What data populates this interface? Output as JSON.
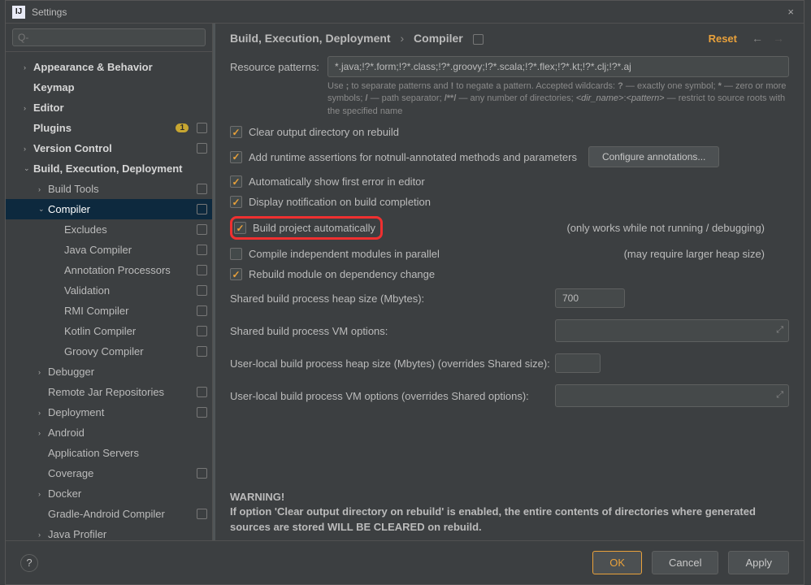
{
  "window": {
    "title": "Settings",
    "close": "×"
  },
  "search_placeholder": "Q-",
  "sidebar": {
    "items": [
      {
        "label": "Appearance & Behavior",
        "arrow": "›",
        "bold": true
      },
      {
        "label": "Keymap",
        "arrow": "",
        "bold": true
      },
      {
        "label": "Editor",
        "arrow": "›",
        "bold": true
      },
      {
        "label": "Plugins",
        "arrow": "",
        "bold": true,
        "count": "1",
        "proj": true
      },
      {
        "label": "Version Control",
        "arrow": "›",
        "bold": true,
        "proj": true
      },
      {
        "label": "Build, Execution, Deployment",
        "arrow": "⌄",
        "bold": true,
        "expanded": true
      },
      {
        "label": "Build Tools",
        "arrow": "›",
        "lvl": 2,
        "proj": true
      },
      {
        "label": "Compiler",
        "arrow": "⌄",
        "lvl": 2,
        "proj": true,
        "selected": true
      },
      {
        "label": "Excludes",
        "lvl": 3,
        "proj": true
      },
      {
        "label": "Java Compiler",
        "lvl": 3,
        "proj": true
      },
      {
        "label": "Annotation Processors",
        "lvl": 3,
        "proj": true
      },
      {
        "label": "Validation",
        "lvl": 3,
        "proj": true
      },
      {
        "label": "RMI Compiler",
        "lvl": 3,
        "proj": true
      },
      {
        "label": "Kotlin Compiler",
        "lvl": 3,
        "proj": true
      },
      {
        "label": "Groovy Compiler",
        "lvl": 3,
        "proj": true
      },
      {
        "label": "Debugger",
        "arrow": "›",
        "lvl": 2
      },
      {
        "label": "Remote Jar Repositories",
        "lvl": 2,
        "proj": true
      },
      {
        "label": "Deployment",
        "arrow": "›",
        "lvl": 2,
        "proj": true
      },
      {
        "label": "Android",
        "arrow": "›",
        "lvl": 2
      },
      {
        "label": "Application Servers",
        "lvl": 2
      },
      {
        "label": "Coverage",
        "lvl": 2,
        "proj": true
      },
      {
        "label": "Docker",
        "arrow": "›",
        "lvl": 2
      },
      {
        "label": "Gradle-Android Compiler",
        "lvl": 2,
        "proj": true
      },
      {
        "label": "Java Profiler",
        "arrow": "›",
        "lvl": 2
      }
    ]
  },
  "breadcrumb": {
    "a": "Build, Execution, Deployment",
    "b": "Compiler",
    "reset": "Reset"
  },
  "form": {
    "resource_patterns_label": "Resource patterns:",
    "resource_patterns_value": "*.java;!?*.form;!?*.class;!?*.groovy;!?*.scala;!?*.flex;!?*.kt;!?*.clj;!?*.aj",
    "resource_help": "Use ; to separate patterns and ! to negate a pattern. Accepted wildcards: ? — exactly one symbol; * — zero or more symbols; / — path separator; /**/ — any number of directories; <dir_name>:<pattern> — restrict to source roots with the specified name",
    "cb_clear_output": "Clear output directory on rebuild",
    "cb_add_runtime": "Add runtime assertions for notnull-annotated methods and parameters",
    "configure_annotations": "Configure annotations...",
    "cb_auto_first_error": "Automatically show first error in editor",
    "cb_display_notif": "Display notification on build completion",
    "cb_build_auto": "Build project automatically",
    "note_build_auto": "(only works while not running / debugging)",
    "cb_compile_parallel": "Compile independent modules in parallel",
    "note_compile_parallel": "(may require larger heap size)",
    "cb_rebuild_dep": "Rebuild module on dependency change",
    "shared_heap_label": "Shared build process heap size (Mbytes):",
    "shared_heap_value": "700",
    "shared_vm_label": "Shared build process VM options:",
    "user_heap_label": "User-local build process heap size (Mbytes) (overrides Shared size):",
    "user_vm_label": "User-local build process VM options (overrides Shared options):",
    "warning_title": "WARNING!",
    "warning_body": "If option 'Clear output directory on rebuild' is enabled, the entire contents of directories where generated sources are stored WILL BE CLEARED on rebuild."
  },
  "footer": {
    "help": "?",
    "ok": "OK",
    "cancel": "Cancel",
    "apply": "Apply"
  }
}
